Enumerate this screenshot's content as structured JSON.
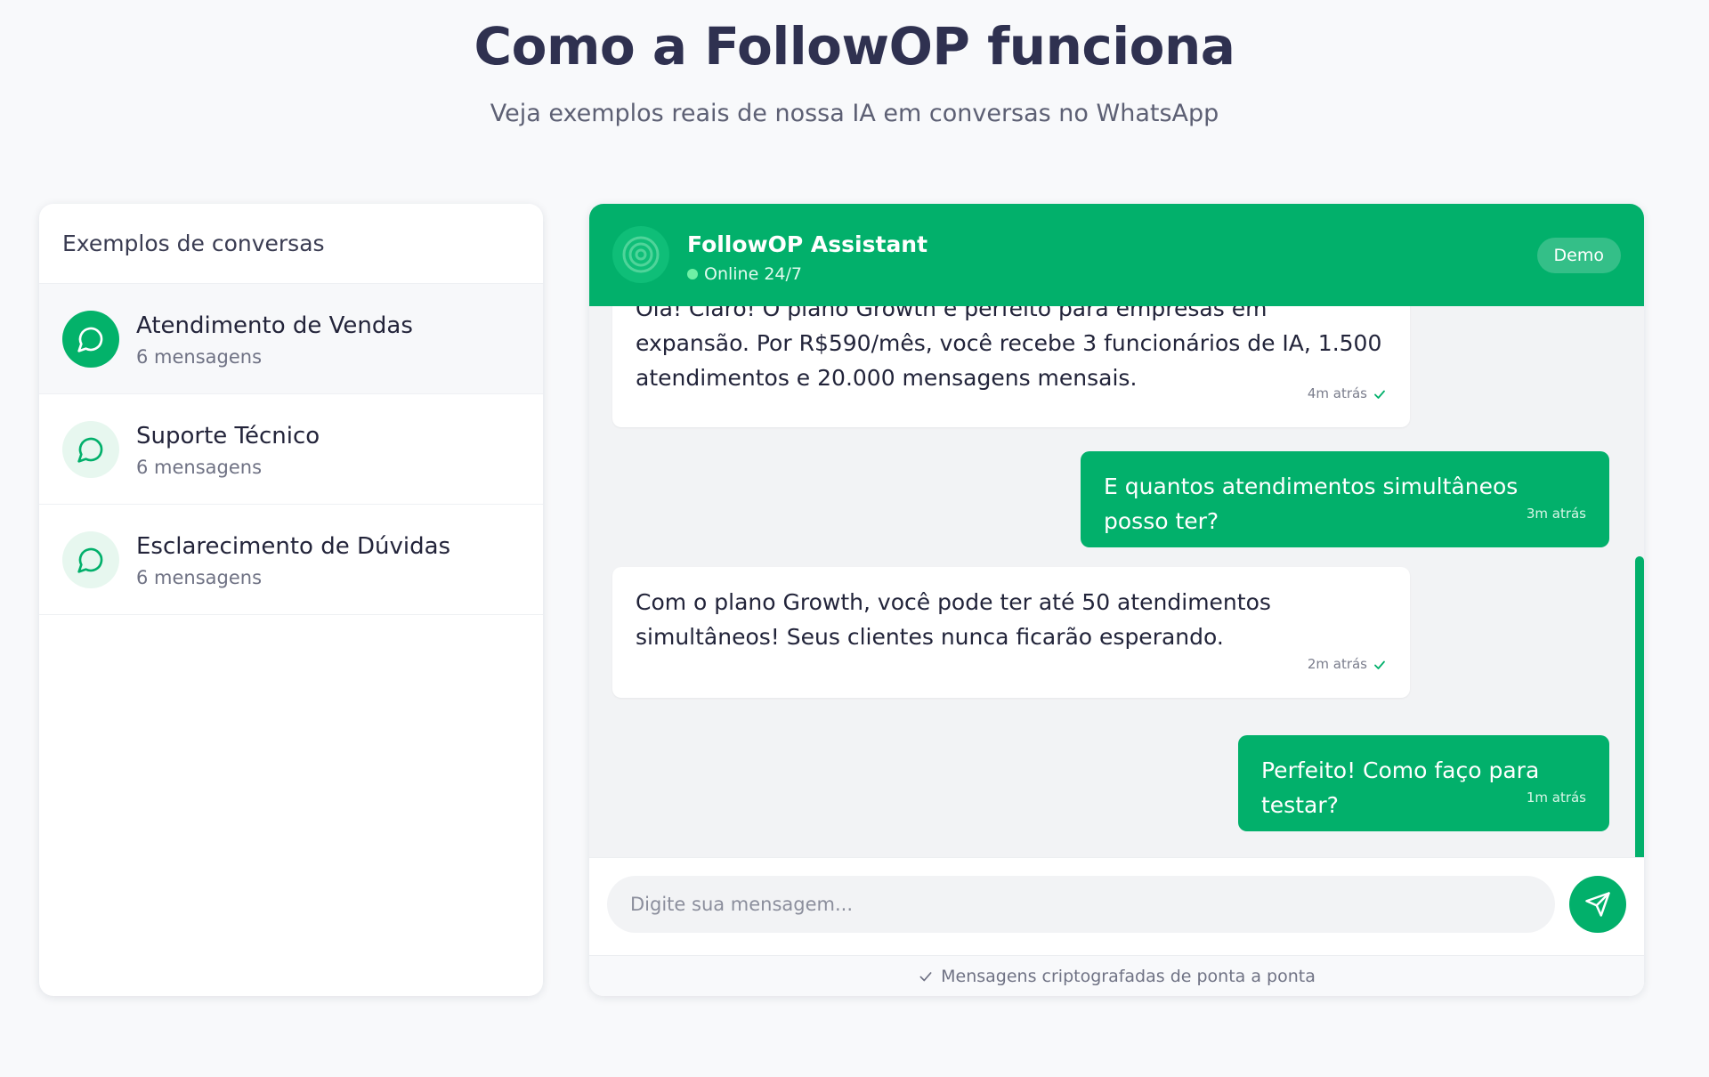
{
  "hero": {
    "title": "Como a FollowOP funciona",
    "subtitle": "Veja exemplos reais de nossa IA em conversas no WhatsApp"
  },
  "sidebar": {
    "title": "Exemplos de conversas",
    "items": [
      {
        "name": "Atendimento de Vendas",
        "count": "6 mensagens",
        "active": true
      },
      {
        "name": "Suporte Técnico",
        "count": "6 mensagens",
        "active": false
      },
      {
        "name": "Esclarecimento de Dúvidas",
        "count": "6 mensagens",
        "active": false
      }
    ]
  },
  "chat": {
    "bot_name": "FollowOP Assistant",
    "status": "Online 24/7",
    "badge": "Demo",
    "messages": [
      {
        "from": "bot",
        "text": "Olá! Claro! O plano Growth é perfeito para empresas em expansão. Por R$590/mês, você recebe 3 funcionários de IA, 1.500 atendimentos e 20.000 mensagens mensais.",
        "time": "4m atrás"
      },
      {
        "from": "user",
        "text": "E quantos atendimentos simultâneos posso ter?",
        "time": "3m atrás"
      },
      {
        "from": "bot",
        "text": "Com o plano Growth, você pode ter até 50 atendimentos simultâneos! Seus clientes nunca ficarão esperando.",
        "time": "2m atrás"
      },
      {
        "from": "user",
        "text": "Perfeito! Como faço para testar?",
        "time": "1m atrás"
      }
    ],
    "input_placeholder": "Digite sua mensagem...",
    "footer": "Mensagens criptografadas de ponta a ponta"
  },
  "colors": {
    "accent": "#02b06b",
    "accent_light": "#e7f7ef",
    "chat_bg": "#f2f3f5"
  }
}
